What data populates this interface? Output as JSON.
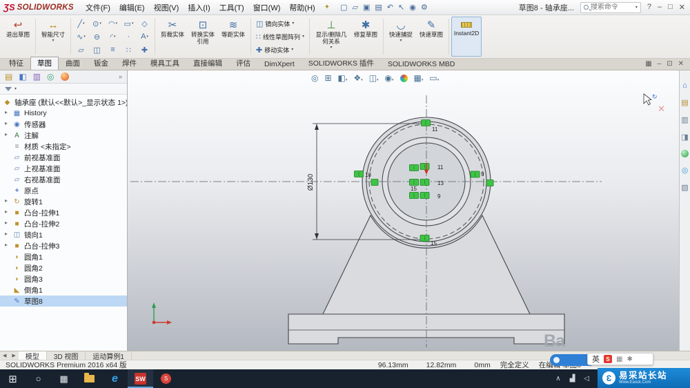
{
  "title_bar": {
    "logo_mark": "ƷS",
    "logo_text": "SOLIDWORKS",
    "menus": [
      "文件(F)",
      "编辑(E)",
      "视图(V)",
      "插入(I)",
      "工具(T)",
      "窗口(W)",
      "帮助(H)"
    ],
    "doc_title": "草图8 - 轴承座...",
    "search_placeholder": "搜索命令"
  },
  "ribbon": {
    "exit_sketch": "退出草图",
    "smart_dimension": "智能尺寸",
    "trim": "剪裁实体",
    "convert": "转换实体引用",
    "offset": "等距实体",
    "mirror": "镜向实体",
    "linear_pattern": "线性草图阵列",
    "move": "移动实体",
    "relations": "显示/删除几何关系",
    "repair": "修复草图",
    "quick_snaps": "快速捕捉",
    "rapid_sketch": "快速草图",
    "instant2d": "Instant2D"
  },
  "command_tabs": [
    "特征",
    "草图",
    "曲面",
    "钣金",
    "焊件",
    "模具工具",
    "直接编辑",
    "评估",
    "DimXpert",
    "SOLIDWORKS 插件",
    "SOLIDWORKS MBD"
  ],
  "tree": {
    "items": [
      {
        "label": "轴承座 (默认<<默认>_显示状态 1>)",
        "icon": "part"
      },
      {
        "label": "History",
        "icon": "history"
      },
      {
        "label": "传感器",
        "icon": "sensor"
      },
      {
        "label": "注解",
        "icon": "annotation"
      },
      {
        "label": "材质 <未指定>",
        "icon": "material"
      },
      {
        "label": "前视基准面",
        "icon": "plane"
      },
      {
        "label": "上视基准面",
        "icon": "plane"
      },
      {
        "label": "右视基准面",
        "icon": "plane"
      },
      {
        "label": "原点",
        "icon": "origin"
      },
      {
        "label": "旋转1",
        "icon": "revolve"
      },
      {
        "label": "凸台-拉伸1",
        "icon": "extrude"
      },
      {
        "label": "凸台-拉伸2",
        "icon": "extrude"
      },
      {
        "label": "镜向1",
        "icon": "mirror"
      },
      {
        "label": "凸台-拉伸3",
        "icon": "extrude"
      },
      {
        "label": "圆角1",
        "icon": "fillet"
      },
      {
        "label": "圆角2",
        "icon": "fillet"
      },
      {
        "label": "圆角3",
        "icon": "fillet"
      },
      {
        "label": "倒角1",
        "icon": "chamfer"
      },
      {
        "label": "草图8",
        "icon": "sketch"
      }
    ]
  },
  "viewport": {
    "dimension": "Ø130",
    "markers": {
      "top": "11",
      "left": "18",
      "right": "9",
      "center_top": "11",
      "center_mid": "13",
      "center_low": "15",
      "center_bottom": "9",
      "bottom": "15"
    }
  },
  "bottom_tabs": [
    "模型",
    "3D 视图",
    "运动算例1"
  ],
  "status_bar": {
    "product": "SOLIDWORKS Premium 2016 x64 版",
    "x": "96.13mm",
    "y": "12.82mm",
    "z": "0mm",
    "state": "完全定义",
    "editing": "在编辑 草图8"
  },
  "ime": {
    "lang": "英"
  },
  "watermark": {
    "title": "易采站长站",
    "sub": "Www.Easck.Com"
  },
  "baidu": {
    "text": "Ba"
  },
  "colors": {
    "accent_blue": "#1278c8",
    "sketch_green": "#3fc445",
    "sw_red": "#c8102e"
  },
  "icons": {
    "pin": "✦",
    "new": "▢",
    "open": "▱",
    "save": "▣",
    "print": "▤",
    "undo": "↶",
    "select": "↖",
    "rebuild": "◉",
    "options": "⚙",
    "help": "?",
    "min": "‒",
    "max": "□",
    "restore": "⊡",
    "close": "✕",
    "panel": "▦",
    "exit": "↩",
    "smartdim": "↔",
    "sketch_grid": [
      "╱",
      "⊙",
      "◠",
      "▭",
      "◇",
      "∿",
      "⊖",
      "◜",
      "∙",
      "A",
      "▱",
      "◫",
      "≡",
      "∷",
      "✚"
    ],
    "trim": "✂",
    "convert": "⊡",
    "offset": "≋",
    "mirror": "◫",
    "linear": "∷",
    "move": "✚",
    "relations": "⊥",
    "repair": "✱",
    "snaps": "◡",
    "rapid": "✎",
    "zoom": "◎",
    "zoomarea": "⊞",
    "section": "◧",
    "cube": "❖",
    "display": "◫",
    "eye": "◉",
    "scene": "▦",
    "monitor": "▭",
    "home": "⌂",
    "library": "▤",
    "explorer": "▥",
    "palette": "◨",
    "scenes2": "◎",
    "props": "▧",
    "part": "◆",
    "history": "▦",
    "sensor": "◉",
    "annotation": "A",
    "material": "≡",
    "plane": "▱",
    "origin": "+",
    "revolve": "↻",
    "extrude": "■",
    "mirror_f": "◫",
    "fillet": "◗",
    "chamfer": "◣",
    "sketch": "✎",
    "start": "⊞",
    "search_tb": "○",
    "taskview": "▦",
    "edge": "e",
    "sw": "SW",
    "tray_up": "∧",
    "network": "▟",
    "volume": "◁",
    "sogou": "S",
    "easck": "Ɛ",
    "prev": "◀",
    "next": "▶",
    "chev": "»"
  }
}
